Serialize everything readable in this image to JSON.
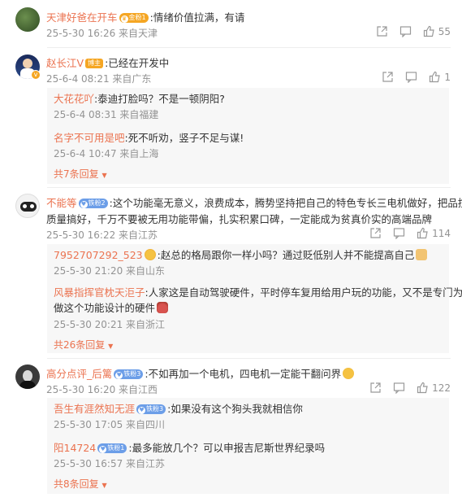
{
  "comments": [
    {
      "user": "天津好爸在开车",
      "badge": "金粉1",
      "text": ":情绪价值拉满，有请",
      "meta": "25-5-30 16:26 来自天津",
      "likes": "55"
    },
    {
      "user": "赵长江V",
      "badge": "博主",
      "text": ":已经在开发中",
      "meta": "25-6-4 08:21 来自广东",
      "likes": "1",
      "replies": [
        {
          "user": "大花花吖",
          "text": ":泰迪打脸吗？不是一顿阴阳?",
          "meta": "25-6-4 08:31 来自福建"
        },
        {
          "user": "名字不可用是吧",
          "text": ":死不听劝，竖子不足与谋!",
          "meta": "25-6-4 10:47 来自上海"
        }
      ],
      "more": "共7条回复"
    },
    {
      "user": "不能等",
      "badge": "铁粉2",
      "text1": ":这个功能毫无意义，浪费成本，腾势坚持把自己的特色专长三电机做好，把品控",
      "text2": "质量搞好，千万不要被无用功能带偏，扎实积累口碑，一定能成为贫真价实的高端品牌",
      "meta": "25-5-30 16:22 来自江苏",
      "likes": "114",
      "replies": [
        {
          "user": "7952707292_523",
          "text": ":赵总的格局跟你一样小吗？通过贬低别人并不能提高自己",
          "meta": "25-5-30 21:20 来自山东"
        },
        {
          "user": "风暴指挥官枕天洰子",
          "text1": ":人家这是自动驾驶硬件，平时停车复用给用户玩的功能，又不是专门为了",
          "text2": "做这个功能设计的硬件",
          "meta": "25-5-30 20:21 来自浙江"
        }
      ],
      "more": "共26条回复"
    },
    {
      "user": "高分点评_后篱",
      "badge": "铁粉3",
      "text": ":不如再加一个电机，四电机一定能干翻问界",
      "meta": "25-5-30 16:20 来自江西",
      "likes": "122",
      "replies": [
        {
          "user": "吾生有涯然知无涯",
          "badge": "铁粉3",
          "text": ":如果没有这个狗头我就相信你",
          "meta": "25-5-30 17:05 来自四川"
        },
        {
          "user": "阳14724",
          "badge": "铁粉1",
          "text": ":最多能放几个？可以申报吉尼斯世界纪录吗",
          "meta": "25-5-30 16:57 来自江苏"
        }
      ],
      "more": "共8条回复"
    }
  ],
  "colors": {
    "username": "#eb7350",
    "meta": "#939393",
    "subbg": "#f7f7f7"
  }
}
